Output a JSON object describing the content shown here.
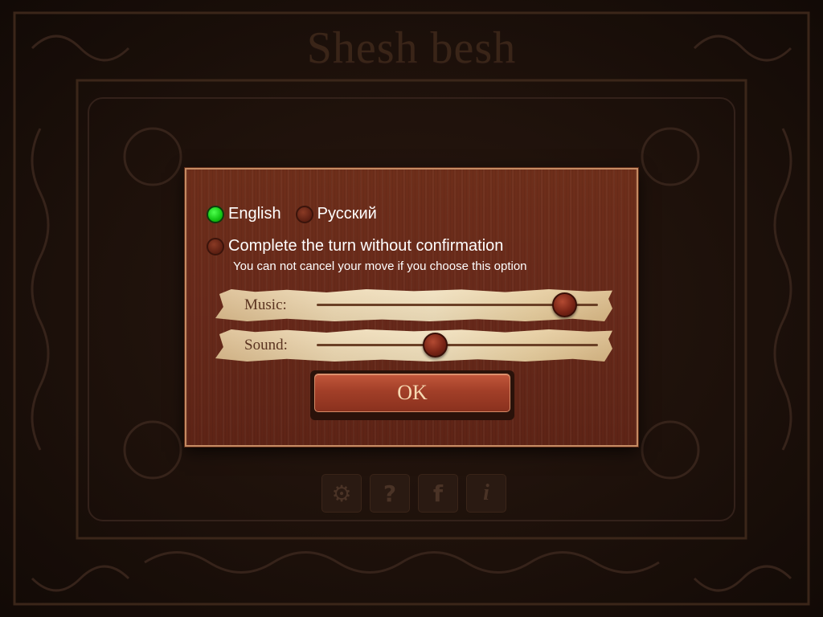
{
  "game": {
    "title": "Shesh besh"
  },
  "bottom_icons": [
    "⚙",
    "?",
    "f",
    "i"
  ],
  "settings": {
    "language_options": [
      {
        "label": "English",
        "selected": true
      },
      {
        "label": "Русский",
        "selected": false
      }
    ],
    "auto_complete": {
      "label": "Complete the turn without confirmation",
      "checked": false,
      "hint": "You can not cancel your move if you choose this option"
    },
    "music": {
      "label": "Music:",
      "level": 0.88
    },
    "sound": {
      "label": "Sound:",
      "level": 0.42
    },
    "ok_label": "OK"
  },
  "colors": {
    "dialog_bg": "#67291a",
    "dialog_border": "#c58b63",
    "selected_radio": "#12c412",
    "paper": "#ecd7b0"
  }
}
